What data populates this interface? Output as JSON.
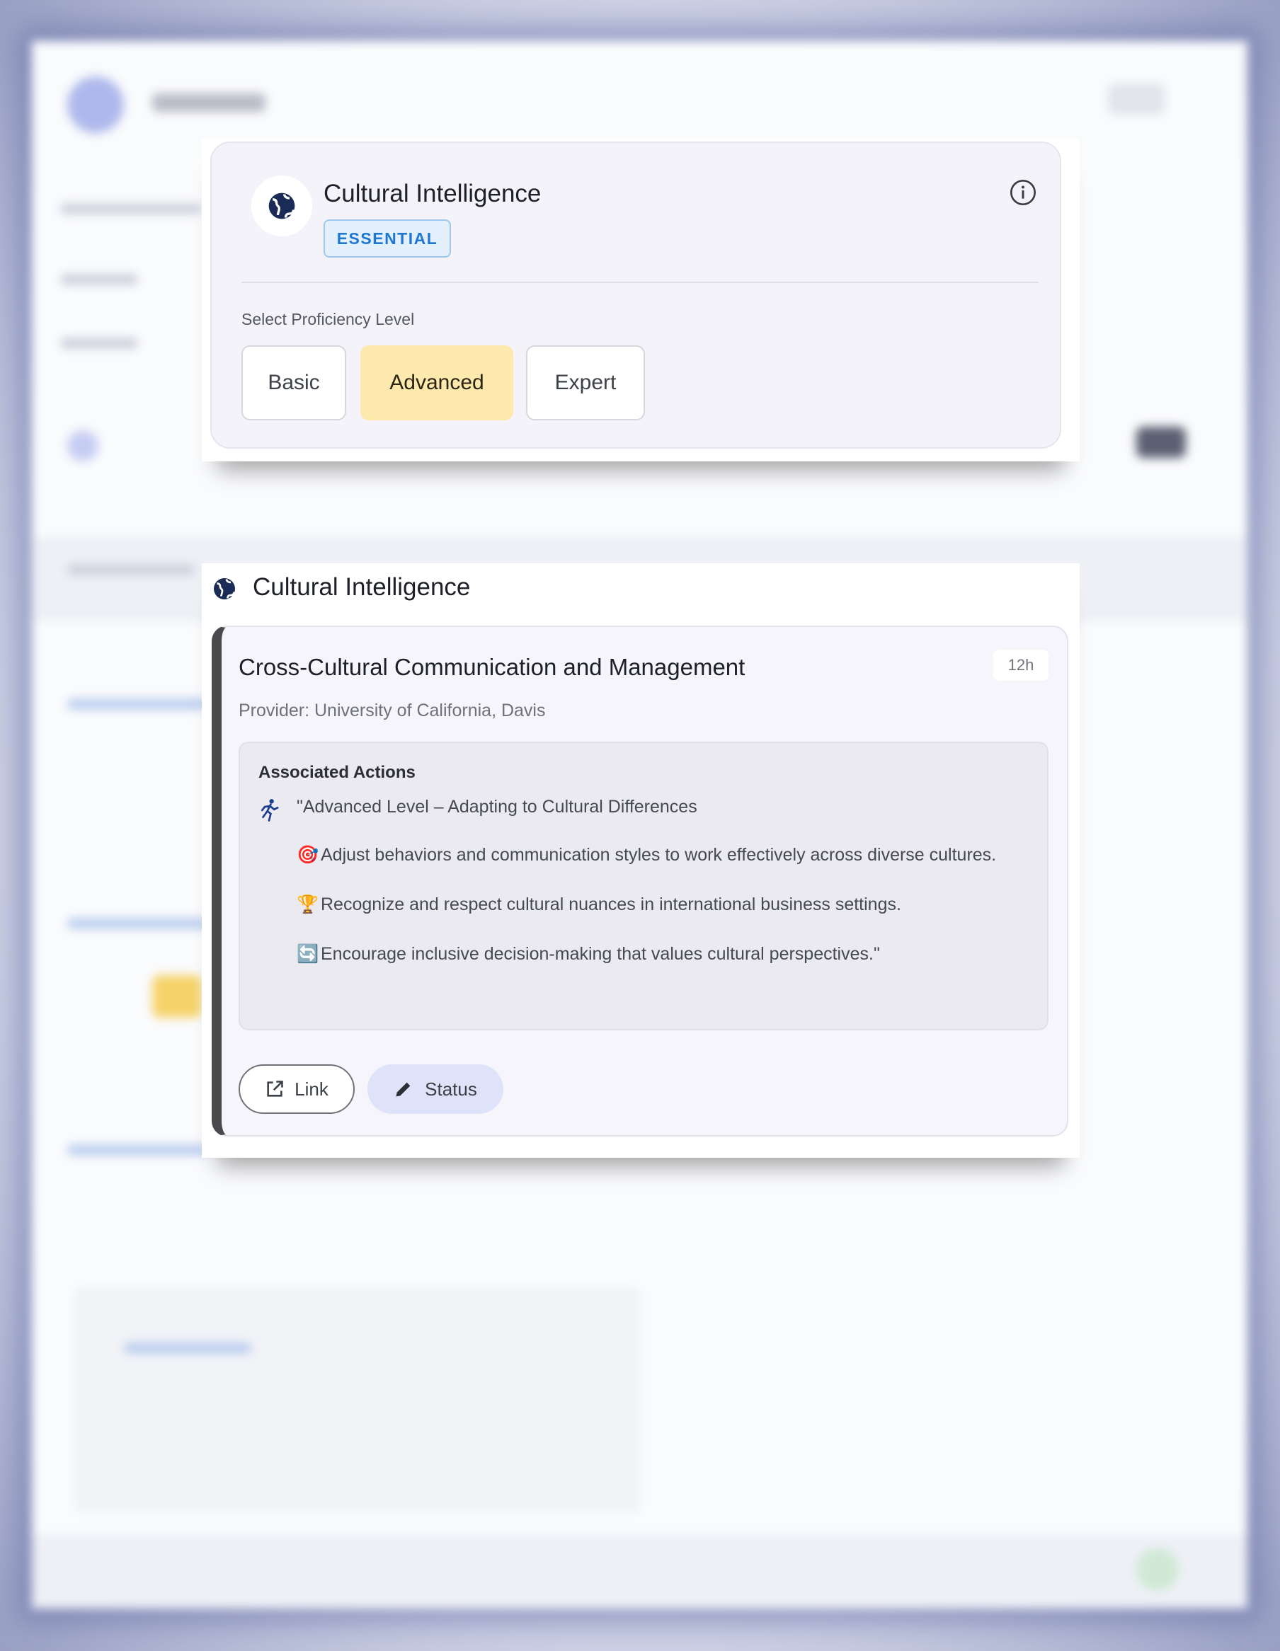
{
  "competency": {
    "title": "Cultural Intelligence",
    "badge": "ESSENTIAL",
    "proficiency_label": "Select Proficiency Level",
    "levels": [
      "Basic",
      "Advanced",
      "Expert"
    ],
    "selected_level": "Advanced",
    "icon": "globe-icon"
  },
  "course_section": {
    "title": "Cultural Intelligence",
    "course": {
      "title": "Cross-Cultural Communication and Management",
      "duration": "12h",
      "provider": "Provider: University of California, Davis",
      "actions_heading": "Associated Actions",
      "actions": [
        {
          "icon": "runner-icon",
          "text": "\"Advanced Level – Adapting to Cultural Differences"
        },
        {
          "icon": "target-icon",
          "text": "Adjust behaviors and communication styles to work effectively across diverse cultures."
        },
        {
          "icon": "trophy-icon",
          "text": "Recognize and respect cultural nuances in international business settings."
        },
        {
          "icon": "cycle-icon",
          "text": "Encourage inclusive decision-making that values cultural perspectives.\""
        }
      ],
      "buttons": {
        "link": "Link",
        "status": "Status"
      }
    }
  },
  "colors": {
    "badge_text": "#1e78d2",
    "selected_level_bg": "#fde8ad",
    "status_button_bg": "#dfe3fa",
    "card_accent": "#4a4a4d"
  }
}
